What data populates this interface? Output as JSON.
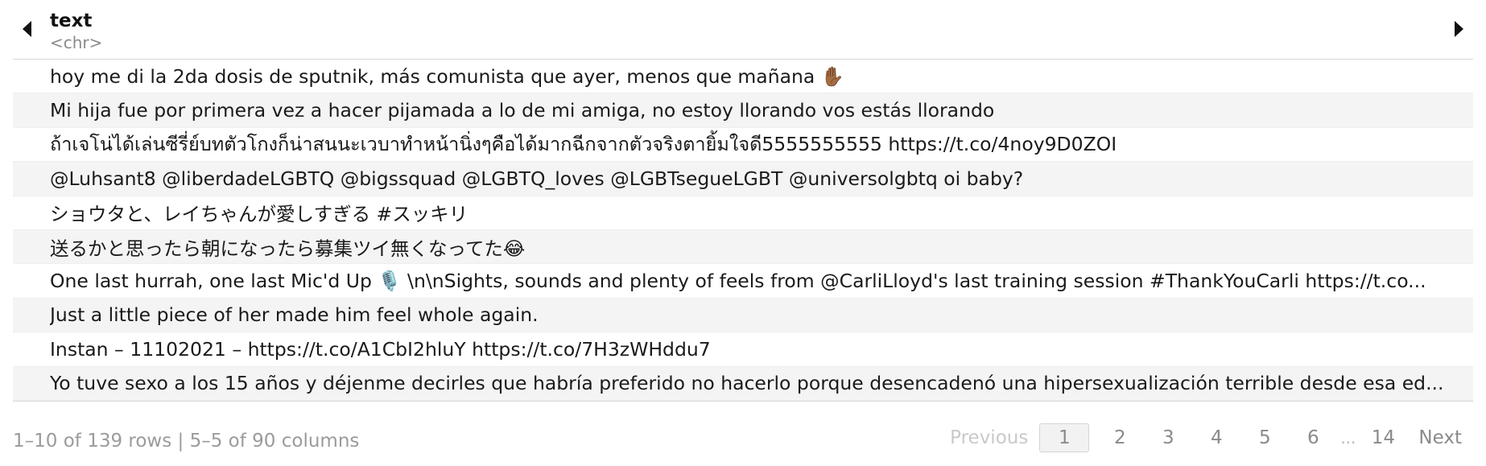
{
  "column": {
    "name": "text",
    "type": "<chr>"
  },
  "rows": [
    "hoy me di la 2da dosis de sputnik, más comunista que ayer, menos que mañana ✋🏾",
    "Mi hija fue por primera vez a hacer pijamada a lo de mi amiga, no estoy llorando vos estás llorando",
    "ถ้าเจโน่ได้เล่นซีรี่ย์บทตัวโกงก็น่าสนนะเวบาทำหน้านิ่งๆคือได้มากฉีกจากตัวจริงตายิ้มใจดี5555555555 https://t.co/4noy9D0ZOI",
    "@Luhsant8 @liberdadeLGBTQ @bigssquad @LGBTQ_loves @LGBTsegueLGBT @universolgbtq oi baby?",
    "ショウタと、レイちゃんが愛しすぎる #スッキリ",
    "送るかと思ったら朝になったら募集ツイ無くなってた😂",
    "One last hurrah, one last Mic'd Up 🎙️ \\n\\nSights, sounds and plenty of feels from @CarliLloyd's last training session #ThankYouCarli https://t.co...",
    "Just a little piece of her made him feel whole again.",
    "Instan – 11102021 – https://t.co/A1CbI2hluY https://t.co/7H3zWHddu7",
    "Yo tuve sexo a los 15 años y déjenme decirles que habría preferido no hacerlo porque desencadenó una hipersexualización terrible desde esa ed..."
  ],
  "footer": {
    "info": "1–10 of 139 rows | 5–5 of 90 columns"
  },
  "pagination": {
    "previous": "Previous",
    "pages": [
      "1",
      "2",
      "3",
      "4",
      "5",
      "6"
    ],
    "ellipsis": "...",
    "last": "14",
    "next": "Next",
    "current": "1"
  },
  "icons": {
    "left": "triangle-left-icon",
    "right": "triangle-right-icon"
  }
}
